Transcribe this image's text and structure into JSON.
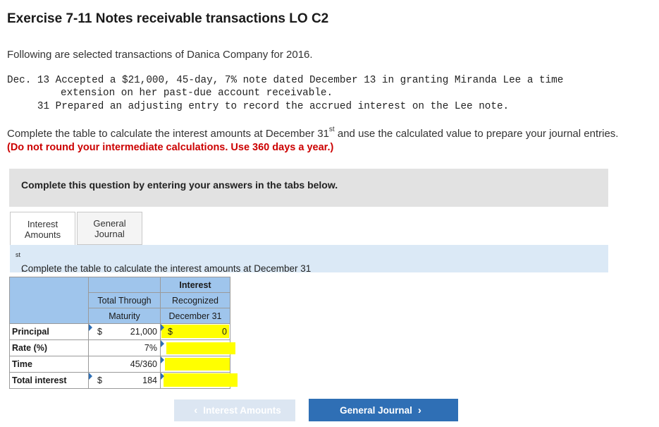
{
  "header": {
    "title": "Exercise 7-11 Notes receivable transactions LO C2",
    "intro": "Following are selected transactions of Danica Company for 2016."
  },
  "transactions": [
    {
      "line1": "Dec. 13 Accepted a $21,000, 45-day, 7% note dated December 13 in granting Miranda Lee a time",
      "line2": "extension on her past-due account receivable."
    },
    {
      "line1": "     31 Prepared an adjusting entry to record the accrued interest on the Lee note."
    }
  ],
  "instructions": {
    "text_before": "Complete the table to calculate the interest amounts at December 31",
    "sup": "st",
    "text_after": " and use the calculated value to prepare your journal entries.",
    "warning": "(Do not round your intermediate calculations. Use 360 days a year.)"
  },
  "question_box": "Complete this question by entering your answers in the tabs below.",
  "tabs": [
    {
      "line1": "Interest",
      "line2": "Amounts",
      "active": true
    },
    {
      "line1": "General",
      "line2": "Journal",
      "active": false
    }
  ],
  "tab_instruction": {
    "text": "Complete the table to calculate the interest amounts at December 31",
    "sup": "st",
    "end": "."
  },
  "table": {
    "col1_header": [
      "",
      "Total Through",
      "Maturity"
    ],
    "col2_header": [
      "Interest",
      "Recognized",
      "December 31"
    ],
    "rows": [
      {
        "label": "Principal",
        "c1_dollar": "$",
        "c1": "21,000",
        "c2_dollar": "$",
        "c2": "0"
      },
      {
        "label": "Rate (%)",
        "c1_dollar": "",
        "c1": "7%",
        "c2_dollar": "",
        "c2": ""
      },
      {
        "label": "Time",
        "c1_dollar": "",
        "c1": "45/360",
        "c2_dollar": "",
        "c2": ""
      },
      {
        "label": "Total interest",
        "c1_dollar": "$",
        "c1": "184",
        "c2_dollar": "",
        "c2": ""
      }
    ]
  },
  "nav": {
    "prev_label": "Interest Amounts",
    "next_label": "General Journal"
  },
  "colors": {
    "accent": "#2f6fb5",
    "header_fill": "#9fc5ec",
    "highlight": "#ffff00",
    "warning": "#cc0000"
  }
}
